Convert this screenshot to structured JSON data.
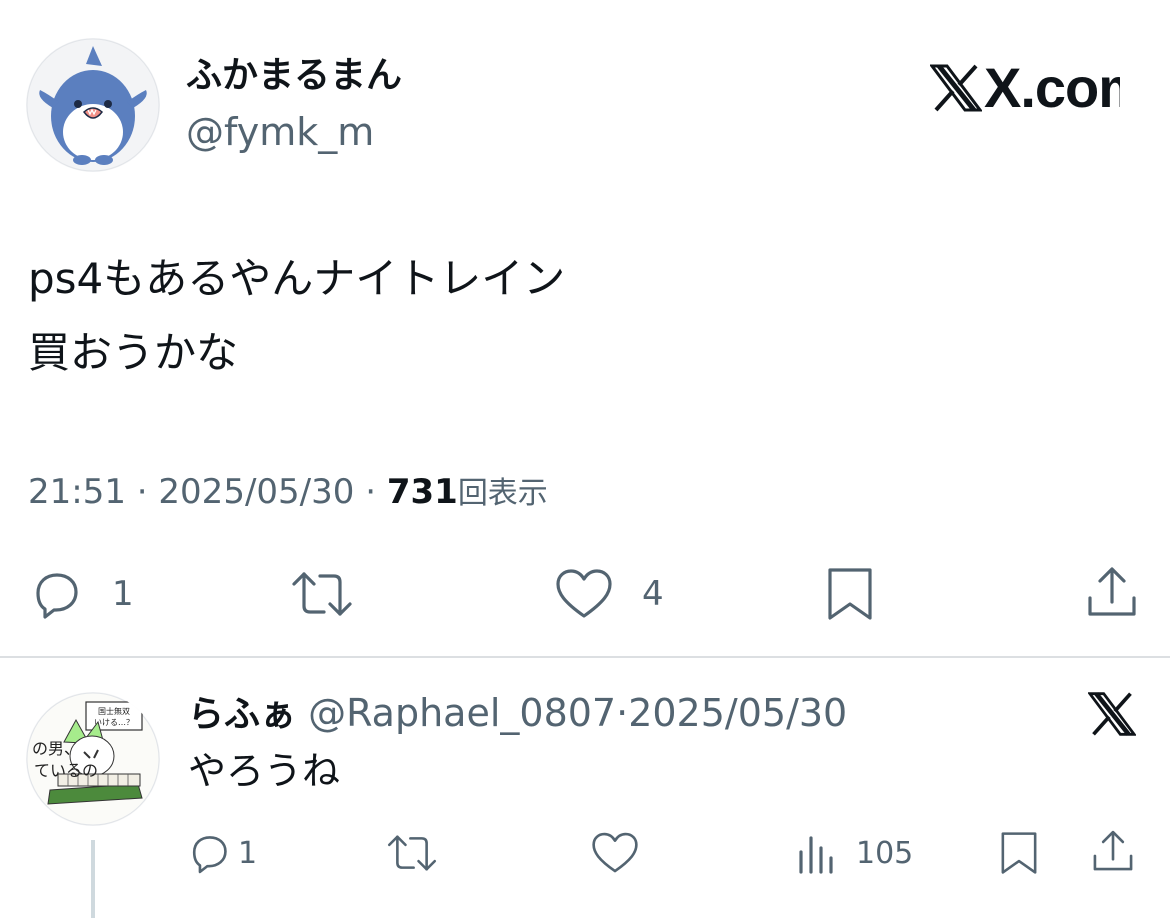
{
  "post": {
    "display_name": "ふかまるまん",
    "handle": "@fymk_m",
    "brand": "X.com",
    "text_line1": "ps4もあるやんナイトレイン",
    "text_line2": "買おうかな",
    "time": "21:51",
    "dot1": "·",
    "date": "2025/05/30",
    "dot2": "·",
    "views_count": "731",
    "views_label": "回表示",
    "actions": {
      "reply_count": "1",
      "like_count": "4"
    }
  },
  "reply": {
    "display_name": "らふぁ",
    "handle": "@Raphael_0807",
    "dot": "·",
    "date": "2025/05/30",
    "text": "やろうね",
    "avatar_sign_text": "国士無双いける…？",
    "avatar_side_text": "の男、ているの",
    "actions": {
      "reply_count": "1",
      "views_count": "105"
    }
  },
  "icons": [
    "avatar-shark",
    "x-logo",
    "reply-icon",
    "retweet-icon",
    "like-icon",
    "bookmark-icon",
    "share-icon",
    "views-icon"
  ],
  "colors": {
    "text": "#0f1419",
    "muted": "#536471",
    "divider": "#dcdfe2",
    "shark": "#5b7fbf"
  }
}
